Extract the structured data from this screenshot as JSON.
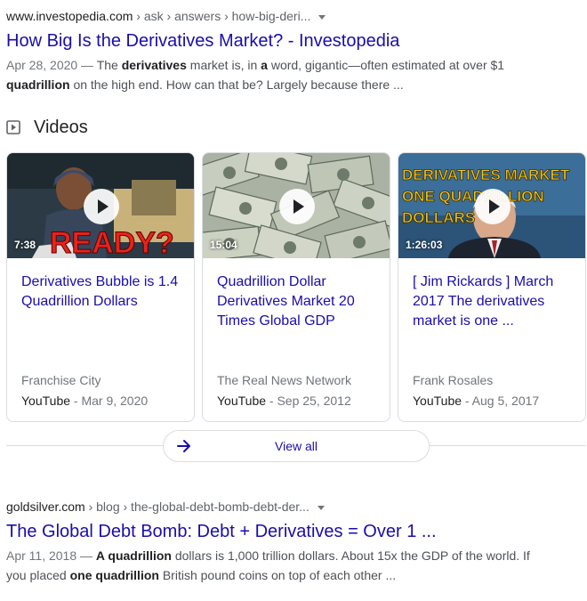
{
  "result1": {
    "site": "www.investopedia.com",
    "path": " › ask › answers › how-big-deri...",
    "title": "How Big Is the Derivatives Market? - Investopedia",
    "date": "Apr 28, 2020 — ",
    "snippet_parts": [
      "The ",
      "derivatives",
      " market is, in ",
      "a",
      " word, gigantic—often estimated at over $1 ",
      "quadrillion",
      " on the high end. How can that be? Largely because there ..."
    ]
  },
  "videos": {
    "heading": "Videos",
    "view_all": "View all",
    "cards": [
      {
        "duration": "7:38",
        "thumb_text": "READY?",
        "title": "Derivatives Bubble is 1.4 Quadrillion Dollars",
        "channel": "Franchise City",
        "source": "YouTube",
        "date": " - Mar 9, 2020"
      },
      {
        "duration": "15:04",
        "title": "Quadrillion Dollar Derivatives Market 20 Times Global GDP",
        "channel": "The Real News Network",
        "source": "YouTube",
        "date": " - Sep 25, 2012"
      },
      {
        "duration": "1:26:03",
        "thumb_lines": [
          "DERIVATIVES MARKET",
          "ONE QUADRILLION",
          "DOLLARS"
        ],
        "title": "[ Jim Rickards ] March 2017 The derivatives market is one ...",
        "channel": "Frank Rosales",
        "source": "YouTube",
        "date": " - Aug 5, 2017"
      }
    ]
  },
  "result2": {
    "site": "goldsilver.com",
    "path": " › blog › the-global-debt-bomb-debt-der...",
    "title": "The Global Debt Bomb: Debt + Derivatives = Over 1 ...",
    "date": "Apr 11, 2018 — ",
    "snippet_parts": [
      "A quadrillion",
      " dollars is 1,000 trillion dollars. About 15x the GDP of the world. If you placed ",
      "one quadrillion",
      " British pound coins on top of each other ..."
    ]
  }
}
